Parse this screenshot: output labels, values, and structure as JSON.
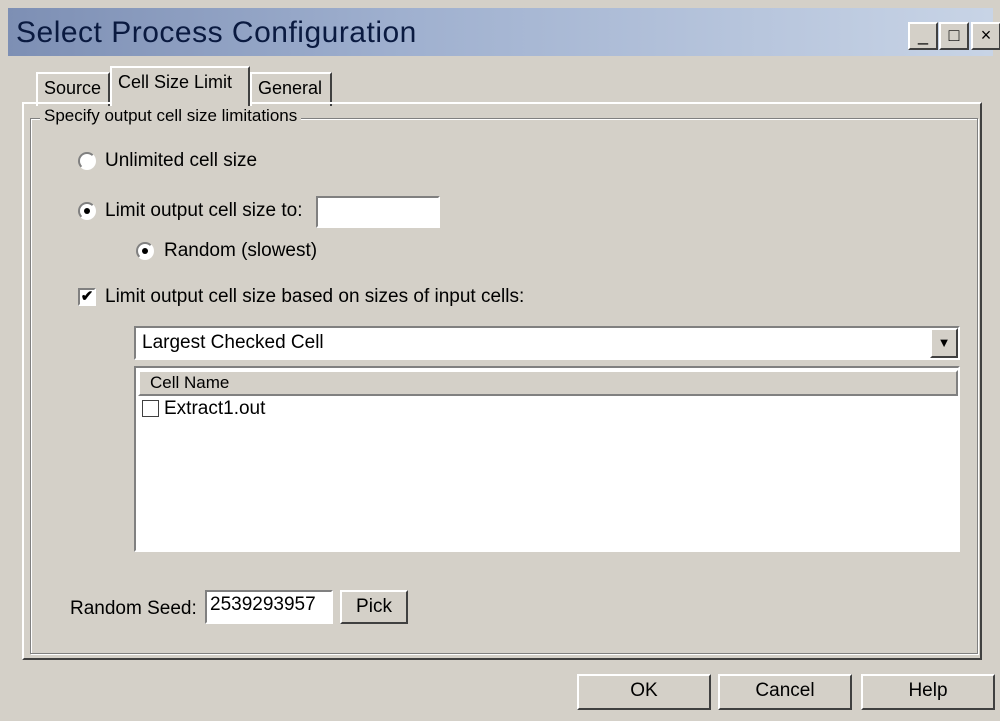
{
  "window": {
    "title": "Select Process Configuration",
    "minimize": "_",
    "maximize": "□",
    "close": "×"
  },
  "tabs": [
    {
      "label": "Source",
      "selected": false
    },
    {
      "label": "Cell Size Limit",
      "selected": true
    },
    {
      "label": "General",
      "selected": false
    }
  ],
  "group": {
    "legend": "Specify output cell size limitations"
  },
  "options": {
    "unlimited": {
      "label": "Unlimited cell size",
      "checked": false
    },
    "limit_to": {
      "label": "Limit output cell size to:",
      "checked": true,
      "value": ""
    },
    "random": {
      "label": "Random (slowest)",
      "checked": true
    },
    "based_on_inputs": {
      "label": "Limit output cell size based on sizes of input cells:",
      "checked": true,
      "checkmark": "✔"
    }
  },
  "dropdown": {
    "selected": "Largest Checked Cell",
    "arrow": "▼"
  },
  "cell_list": {
    "header": "Cell Name",
    "rows": [
      {
        "name": "Extract1.out",
        "checked": false
      }
    ]
  },
  "random_seed": {
    "label": "Random Seed:",
    "value": "2539293957",
    "pick_label": "Pick"
  },
  "footer": {
    "ok": "OK",
    "cancel": "Cancel",
    "help": "Help"
  },
  "colors": {
    "face": "#d4d0c8",
    "title_start": "#7d8fb4",
    "title_end": "#c8d4e6"
  }
}
